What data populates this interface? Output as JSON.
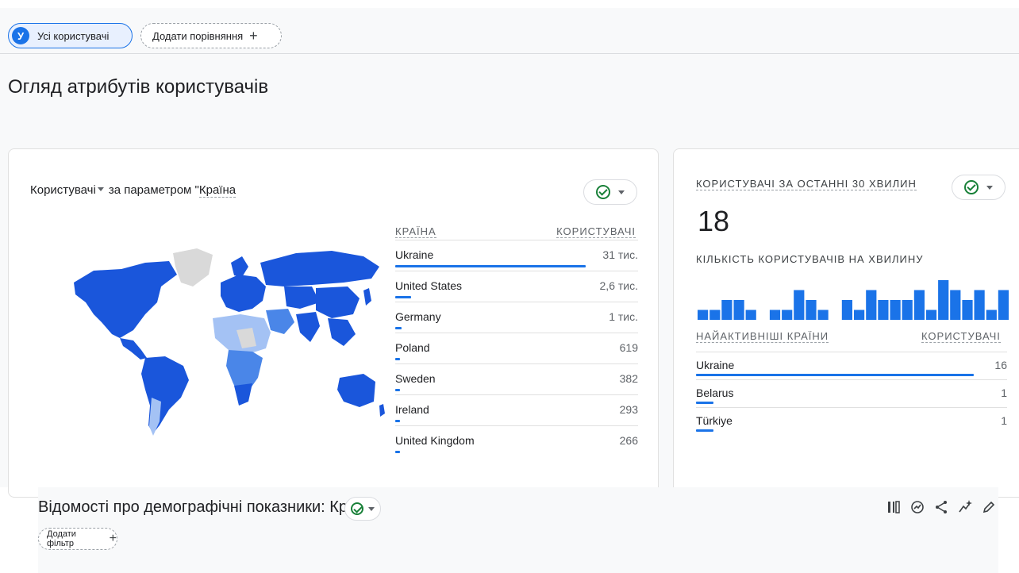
{
  "filters": {
    "segment_initial": "У",
    "segment_label": "Усі користувачі",
    "compare_label": "Додати порівняння",
    "plus": "+"
  },
  "page": {
    "title": "Огляд атрибутів користувачів"
  },
  "country_card": {
    "metric": "Користувачі",
    "by_text": "за параметром \"",
    "dimension": "Країна",
    "table": {
      "col_country": "КРАЇНА",
      "col_users": "КОРИСТУВАЧІ",
      "rows": [
        {
          "country": "Ukraine",
          "users_label": "31 тис.",
          "share": 1.0
        },
        {
          "country": "United States",
          "users_label": "2,6 тис.",
          "share": 0.084
        },
        {
          "country": "Germany",
          "users_label": "1 тис.",
          "share": 0.032
        },
        {
          "country": "Poland",
          "users_label": "619",
          "share": 0.02
        },
        {
          "country": "Sweden",
          "users_label": "382",
          "share": 0.012
        },
        {
          "country": "Ireland",
          "users_label": "293",
          "share": 0.009
        },
        {
          "country": "United Kingdom",
          "users_label": "266",
          "share": 0.008
        }
      ]
    }
  },
  "realtime_card": {
    "title": "КОРИСТУВАЧІ ЗА ОСТАННІ 30 ХВИЛИН",
    "value": "18",
    "per_minute_label": "КІЛЬКІСТЬ КОРИСТУВАЧІВ НА ХВИЛИНУ",
    "per_minute": [
      1,
      1,
      2,
      2,
      1,
      0,
      1,
      1,
      3,
      2,
      1,
      0,
      2,
      1,
      3,
      2,
      2,
      2,
      3,
      1,
      4,
      3,
      2,
      3,
      1,
      3
    ],
    "top_countries_label": "НАЙАКТИВНІШІ КРАЇНИ",
    "users_label": "КОРИСТУВАЧІ",
    "rows": [
      {
        "country": "Ukraine",
        "users": "16",
        "share": 1.0
      },
      {
        "country": "Belarus",
        "users": "1",
        "share": 0.0625
      },
      {
        "country": "Türkiye",
        "users": "1",
        "share": 0.0625
      }
    ]
  },
  "demographics": {
    "title": "Відомості про демографічні показники: Країна",
    "add_filter": "Додати фільтр",
    "plus": "+"
  },
  "colors": {
    "accent": "#1a73e8",
    "map_dark": "#1a56db",
    "map_mid": "#4a86e8",
    "map_light": "#a4c2f4",
    "map_none": "#d9d9d9",
    "ok_green": "#188038"
  }
}
